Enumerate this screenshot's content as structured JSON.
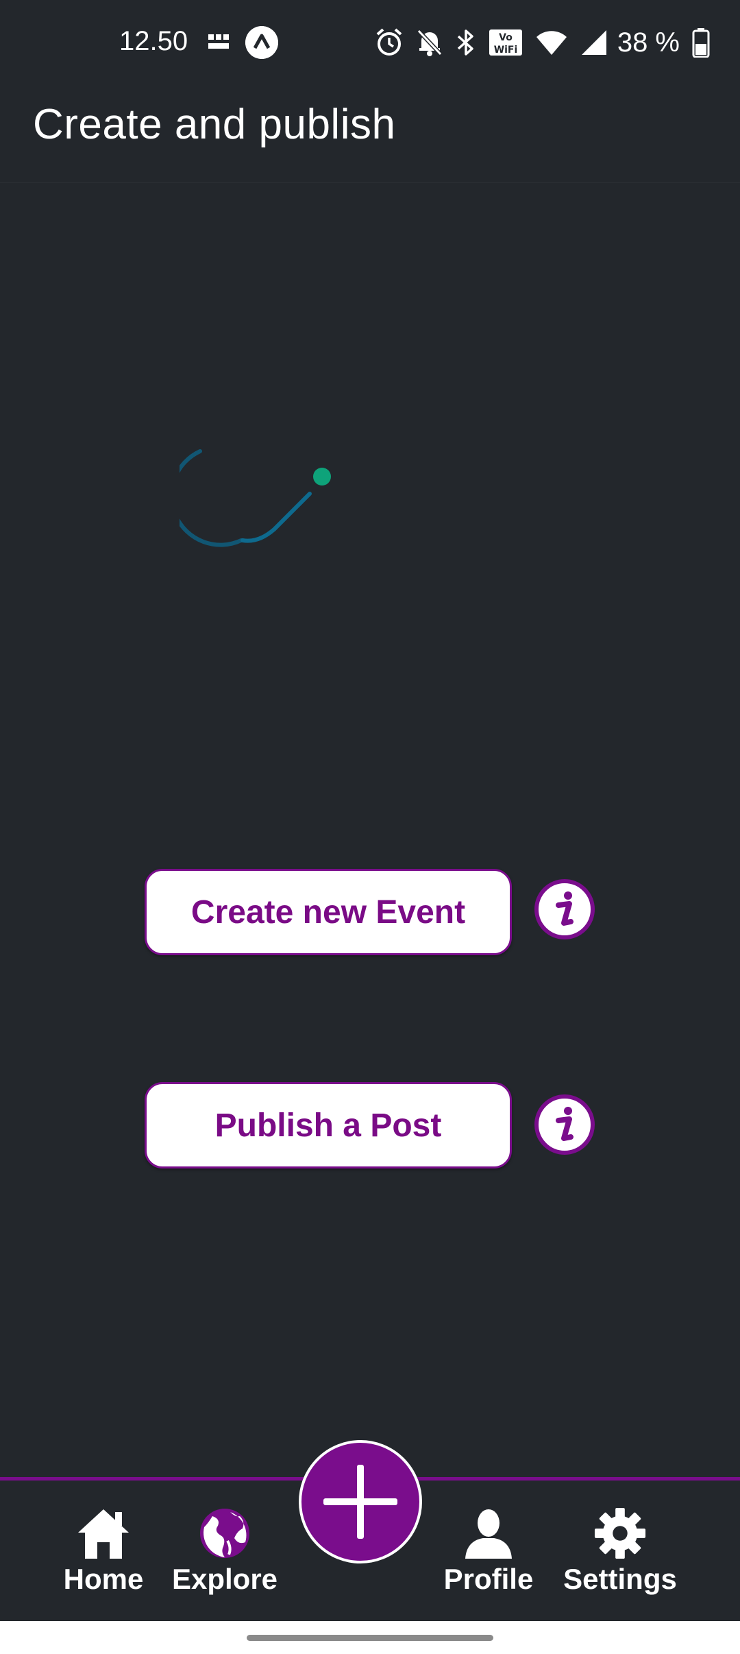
{
  "status_bar": {
    "time": "12.50",
    "battery_percent": "38 %",
    "icons": [
      "bbc-news-icon",
      "app-notification-icon",
      "alarm-icon",
      "muted-bell-icon",
      "bluetooth-icon",
      "vowifi-icon",
      "wifi-icon",
      "cellular-signal-icon",
      "battery-icon"
    ]
  },
  "app_bar": {
    "title": "Create and publish"
  },
  "loading": {
    "icon": "loading-spinner",
    "arc_color": "#0e6a8e",
    "dot_color": "#0ea37a"
  },
  "actions": {
    "create_event_label": "Create new Event",
    "publish_post_label": "Publish a Post",
    "info_icon": "info-icon"
  },
  "bottom_nav": {
    "items": [
      {
        "label": "Home",
        "icon": "home-icon"
      },
      {
        "label": "Explore",
        "icon": "globe-icon"
      },
      {
        "label": "Profile",
        "icon": "person-icon"
      },
      {
        "label": "Settings",
        "icon": "gear-icon"
      }
    ],
    "fab_icon": "plus-icon"
  },
  "colors": {
    "background": "#23272c",
    "accent": "#7a0d8c",
    "button_text": "#7a0b86",
    "button_bg": "#ffffff"
  }
}
